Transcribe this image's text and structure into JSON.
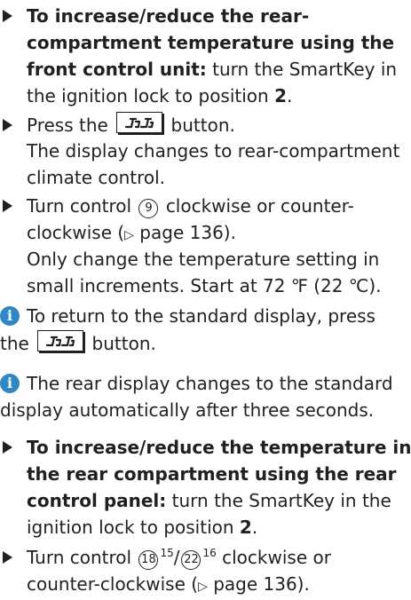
{
  "s1": {
    "l1": "To increase/reduce the rear-",
    "l2": "compartment temperature using the",
    "l3_bold": "front control unit:",
    "l3_rest": " turn the SmartKey in",
    "l4_a": "the ignition lock to position ",
    "l4_b": "2",
    "l4_c": "."
  },
  "s2": {
    "l1_a": "Press the",
    "l1_b": "button.",
    "l2": "The display changes to rear-compartment",
    "l3": "climate control."
  },
  "s3": {
    "l1_a": "Turn control",
    "ctrl": "9",
    "l1_b": "clockwise or counter-",
    "l2_a": "clockwise (",
    "arrow": "▷",
    "l2_b": " page 136).",
    "l3": "Only change the temperature setting in",
    "l4": "small increments. Start at 72 ℉ (22 ℃)."
  },
  "n1": {
    "icon": "i",
    "l1": "To return to the standard display, press",
    "l2_a": "the",
    "l2_b": "button."
  },
  "n2": {
    "icon": "i",
    "l1": "The rear display changes to the standard",
    "l2": "display automatically after three seconds."
  },
  "s4": {
    "l1": "To increase/reduce the temperature in",
    "l2": "the rear compartment using the rear",
    "l3_bold": "control panel:",
    "l3_rest": " turn the SmartKey in the",
    "l4_a": "ignition lock to position ",
    "l4_b": "2",
    "l4_c": "."
  },
  "s5": {
    "l1_a": "Turn control",
    "c1": "18",
    "sup1": "15",
    "slash": "/",
    "c2": "22",
    "sup2": "16",
    "l1_b": "clockwise or",
    "l2_a": "counter-clockwise (",
    "arrow": "▷",
    "l2_b": " page 136)."
  },
  "colors": {
    "text": "#231f20",
    "info_icon": "#2f87c7"
  },
  "icons": {
    "bullet": "triangle-bullet-icon",
    "note": "info-icon",
    "key": "rear-climate-key-icon"
  }
}
